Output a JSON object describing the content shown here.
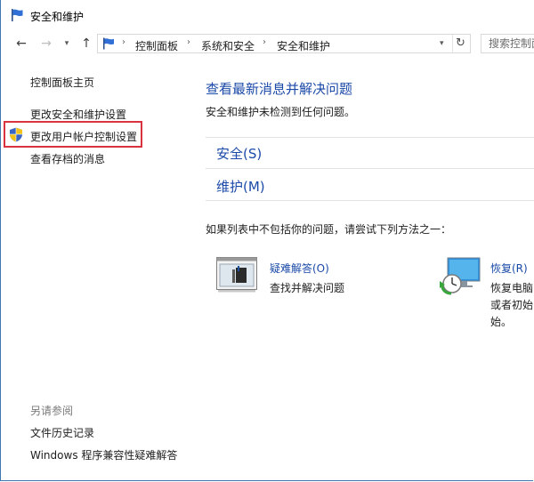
{
  "window": {
    "title": "安全和维护"
  },
  "nav": {
    "back": "←",
    "forward": "→",
    "up": "↑",
    "breadcrumbs": [
      "控制面板",
      "系统和安全",
      "安全和维护"
    ],
    "refresh": "↻",
    "search_placeholder": "搜索控制面板"
  },
  "sidebar": {
    "links": [
      "控制面板主页",
      "更改安全和维护设置",
      "更改用户帐户控制设置",
      "查看存档的消息"
    ],
    "see_also_title": "另请参阅",
    "see_also": [
      "文件历史记录",
      "Windows 程序兼容性疑难解答"
    ]
  },
  "main": {
    "title": "查看最新消息并解决问题",
    "subtitle": "安全和维护未检测到任何问题。",
    "sections": [
      "安全(S)",
      "维护(M)"
    ],
    "try_text": "如果列表中不包括你的问题，请尝试下列方法之一：",
    "tools": [
      {
        "title": "疑难解答(O)",
        "desc_lines": [
          "查找并解决问题"
        ]
      },
      {
        "title": "恢复(R)",
        "desc_lines": [
          "恢复电脑",
          "或者初始",
          "始。"
        ]
      }
    ]
  },
  "colors": {
    "link_blue": "#1b4aa8",
    "highlight_red": "#d9333f",
    "window_border": "#3f78b0"
  }
}
